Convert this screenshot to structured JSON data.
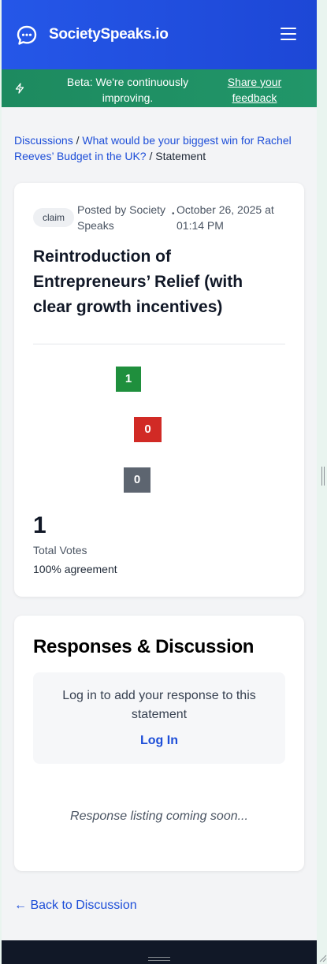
{
  "header": {
    "brand": "SocietySpeaks.io",
    "logo_icon": "chat-bubble-icon",
    "menu_icon": "hamburger-menu-icon",
    "bg_color": "#2557e8"
  },
  "beta_banner": {
    "icon": "lightning-bolt-icon",
    "text": "Beta: We're continuously improving.",
    "link": "Share your feedback",
    "bg_color": "#1d8a5f"
  },
  "breadcrumb": {
    "discussions": "Discussions",
    "separator1": " / ",
    "question": "What would be your biggest win for Rachel Reeves’ Budget in the UK?",
    "separator2": " / ",
    "current": "Statement"
  },
  "statement": {
    "badge": "claim",
    "posted_by": "Posted by Society Speaks",
    "dot": "•",
    "date": "October 26, 2025 at 01:14 PM",
    "text": "Reintroduction of Entrepreneurs’ Relief (with clear growth incentives)",
    "votes": {
      "agree": "1",
      "disagree": "0",
      "unsure": "0",
      "agree_color": "#1f8f3d",
      "disagree_color": "#d12a25",
      "unsure_color": "#5d6570"
    },
    "total_votes": "1",
    "total_label": "Total Votes",
    "agreement": "100% agreement"
  },
  "responses": {
    "title": "Responses & Discussion",
    "login_prompt": "Log in to add your response to this statement",
    "login_link": "Log In",
    "coming_soon": "Response listing coming soon..."
  },
  "back_link": "← Back to Discussion"
}
